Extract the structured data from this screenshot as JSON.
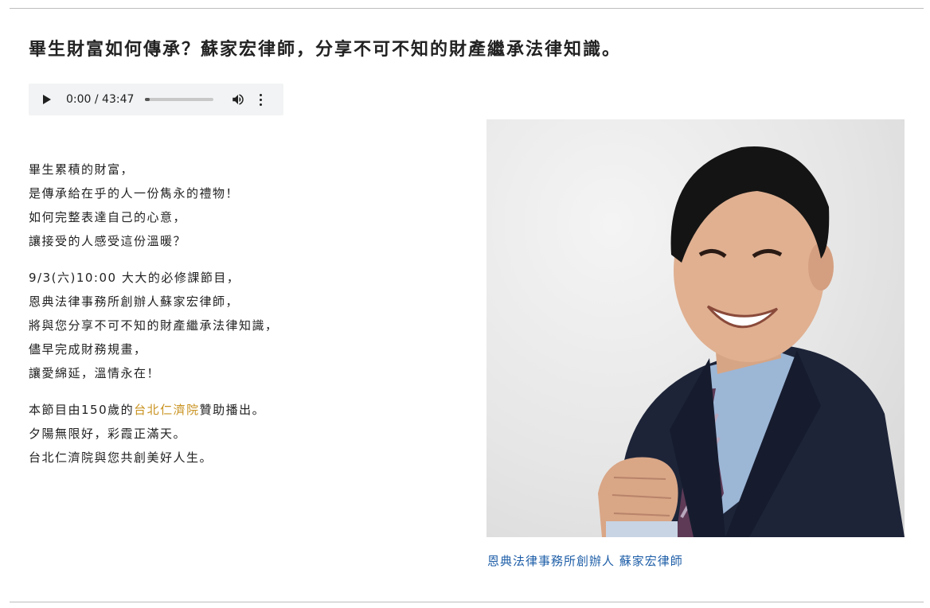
{
  "page": {
    "title": "畢生財富如何傳承？蘇家宏律師，分享不可不知的財產繼承法律知識。"
  },
  "audio": {
    "time": "0:00 / 43:47",
    "progress_fraction": 0.0,
    "icons": {
      "play": "play-icon",
      "volume": "volume-icon",
      "more": "more-vertical-icon"
    }
  },
  "article": {
    "paragraph1": [
      "畢生累積的財富，",
      "是傳承給在乎的人一份雋永的禮物！",
      "如何完整表達自己的心意，",
      "讓接受的人感受這份溫暖？"
    ],
    "paragraph2": [
      "9/3(六)10:00 大大的必修課節目，",
      "恩典法律事務所創辦人蘇家宏律師，",
      "將與您分享不可不知的財產繼承法律知識，",
      "儘早完成財務規畫，",
      "讓愛綿延，溫情永在！"
    ],
    "paragraph3": {
      "line1_prefix": "本節目由150歲的",
      "line1_link": "台北仁濟院",
      "line1_suffix": "贊助播出。",
      "line2": "夕陽無限好，彩霞正滿天。",
      "line3": "台北仁濟院與您共創美好人生。"
    }
  },
  "photo": {
    "caption": "恩典法律事務所創辦人 蘇家宏律師"
  },
  "colors": {
    "link": "#c9921f",
    "caption": "#1f5fa8",
    "audio_bg": "#f1f3f4"
  }
}
